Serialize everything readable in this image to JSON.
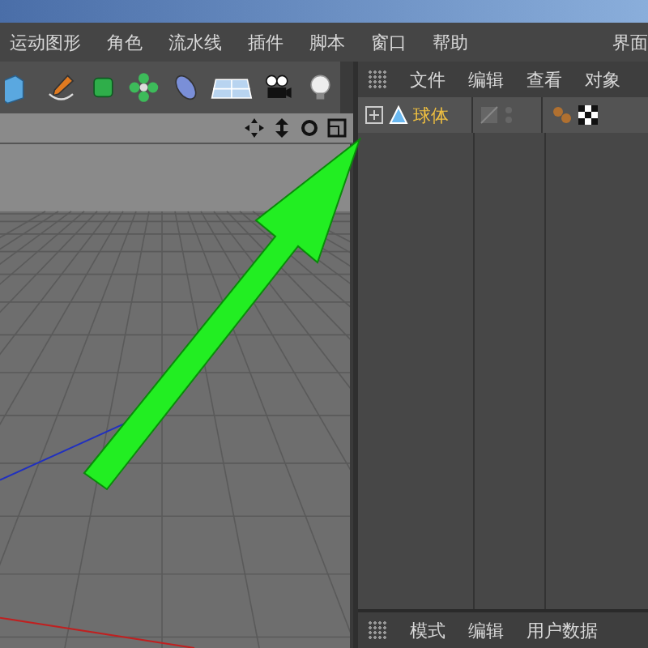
{
  "menu_bar": {
    "items": [
      "运动图形",
      "角色",
      "流水线",
      "插件",
      "脚本",
      "窗口",
      "帮助"
    ],
    "right_item": "界面"
  },
  "object_manager": {
    "menu": [
      "文件",
      "编辑",
      "查看",
      "对象"
    ],
    "objects": [
      {
        "name": "球体",
        "selected": true
      }
    ]
  },
  "attribute_manager": {
    "menu": [
      "模式",
      "编辑",
      "用户数据"
    ]
  }
}
